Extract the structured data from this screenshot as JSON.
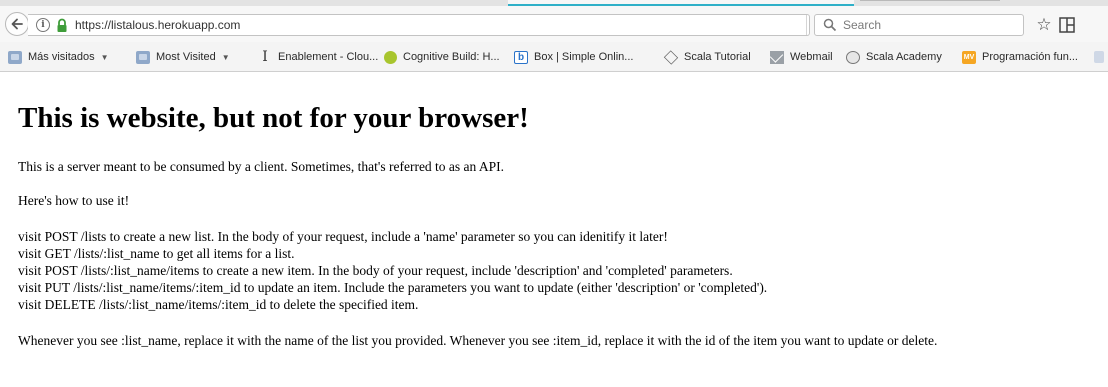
{
  "browser": {
    "url": "https://listalous.herokuapp.com",
    "search_placeholder": "Search",
    "info_glyph": "i",
    "reload_glyph": "C",
    "star_glyph": "☆",
    "bookmarks": [
      {
        "label": "Más visitados",
        "icon": "folder-icon",
        "dropdown": true
      },
      {
        "label": "Most Visited",
        "icon": "folder-icon",
        "dropdown": true
      },
      {
        "label": "Enablement - Clou...",
        "icon": "text-cursor-icon",
        "glyph": "I",
        "dropdown": false
      },
      {
        "label": "Cognitive Build: H...",
        "icon": "green-dot-icon",
        "dropdown": false
      },
      {
        "label": "Box | Simple Onlin...",
        "icon": "box-logo-icon",
        "glyph": "b",
        "dropdown": false
      },
      {
        "label": "Scala Tutorial",
        "icon": "scala-logo-icon",
        "dropdown": false
      },
      {
        "label": "Webmail",
        "icon": "mail-icon",
        "dropdown": false
      },
      {
        "label": "Scala Academy",
        "icon": "globe-icon",
        "dropdown": false
      },
      {
        "label": "Programación fun...",
        "icon": "course-logo-icon",
        "glyph": "MV",
        "dropdown": false
      }
    ],
    "dropdown_glyph": "▼"
  },
  "page": {
    "heading": "This is website, but not for your browser!",
    "intro": "This is a server meant to be consumed by a client. Sometimes, that's referred to as an API.",
    "how_to": "Here's how to use it!",
    "endpoints": [
      "visit POST /lists to create a new list. In the body of your request, include a 'name' parameter so you can idenitify it later!",
      "visit GET /lists/:list_name to get all items for a list.",
      "visit POST /lists/:list_name/items to create a new item. In the body of your request, include 'description' and 'completed' parameters.",
      "visit PUT /lists/:list_name/items/:item_id to update an item. Include the parameters you want to update (either 'description' or 'completed').",
      "visit DELETE /lists/:list_name/items/:item_id to delete the specified item."
    ],
    "footer": "Whenever you see :list_name, replace it with the name of the list you provided. Whenever you see :item_id, replace it with the id of the item you want to update or delete."
  }
}
